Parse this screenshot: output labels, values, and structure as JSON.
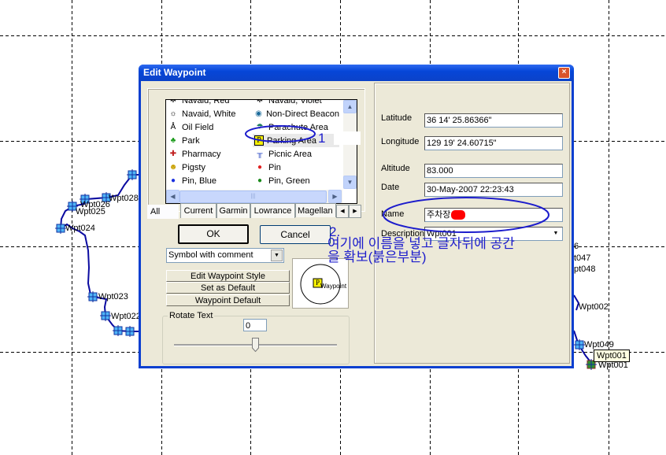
{
  "map": {
    "waypoints": [
      {
        "label": "Wpt028",
        "note": "partially overlapped"
      },
      {
        "label": "Wpt026"
      },
      {
        "label": "Wpt025"
      },
      {
        "label": "Wpt024"
      },
      {
        "label": "Wpt023"
      },
      {
        "label": "Wpt022"
      },
      {
        "label": "6"
      },
      {
        "label": "t047"
      },
      {
        "label": "pt048"
      },
      {
        "label": "Wpt002"
      },
      {
        "label": "Wpt049"
      },
      {
        "label": "Wpt001"
      }
    ],
    "tooltip": "Wpt001",
    "colors": {
      "track": "#0a0aa0",
      "waypoint_fill": "#4fb4f6",
      "grid": "#000000"
    }
  },
  "dialog": {
    "title": "Edit Waypoint",
    "close_label": "×",
    "symbols": [
      [
        "Navaid, Red",
        "Navaid, Violet"
      ],
      [
        "Navaid, White",
        "Non-Direct Beacon"
      ],
      [
        "Oil Field",
        "Parachute Area"
      ],
      [
        "Park",
        "Parking Area"
      ],
      [
        "Pharmacy",
        "Picnic Area"
      ],
      [
        "Pigsty",
        "Pin"
      ],
      [
        "Pin, Blue",
        "Pin, Green"
      ]
    ],
    "selected_symbol": "Parking Area",
    "tabs": {
      "all": "All",
      "current": "Current",
      "garmin": "Garmin",
      "lowrance": "Lowrance",
      "magellan": "Magellan"
    },
    "ok_label": "OK",
    "cancel_label": "Cancel",
    "display_mode": "Symbol with comment",
    "edit_style_label": "Edit Waypoint Style",
    "set_default_label": "Set as Default",
    "waypoint_default_label": "Waypoint Default",
    "preview_text": "Waypoint",
    "preview_symbol": "P",
    "rotate_label": "Rotate Text",
    "rotate_value": "0",
    "rotate_slider_fraction": 0.5,
    "fields": {
      "latitude_label": "Latitude",
      "latitude": "36 14' 25.86366\"",
      "longitude_label": "Longitude",
      "longitude": "129 19' 24.60715\"",
      "altitude_label": "Altitude",
      "altitude": "83.000",
      "date_label": "Date",
      "date": "30-May-2007 22:23:43",
      "name_label": "Name",
      "name": "주차장",
      "description_label": "Description",
      "description": "Wpt001"
    }
  },
  "annotations": {
    "mark1": "1",
    "mark2": "2.",
    "note_line1": "여기에 이름을 넣고 글자뒤에 공간",
    "note_line2": "을 확보(붉은부분)",
    "color": "#1c1ccc"
  }
}
